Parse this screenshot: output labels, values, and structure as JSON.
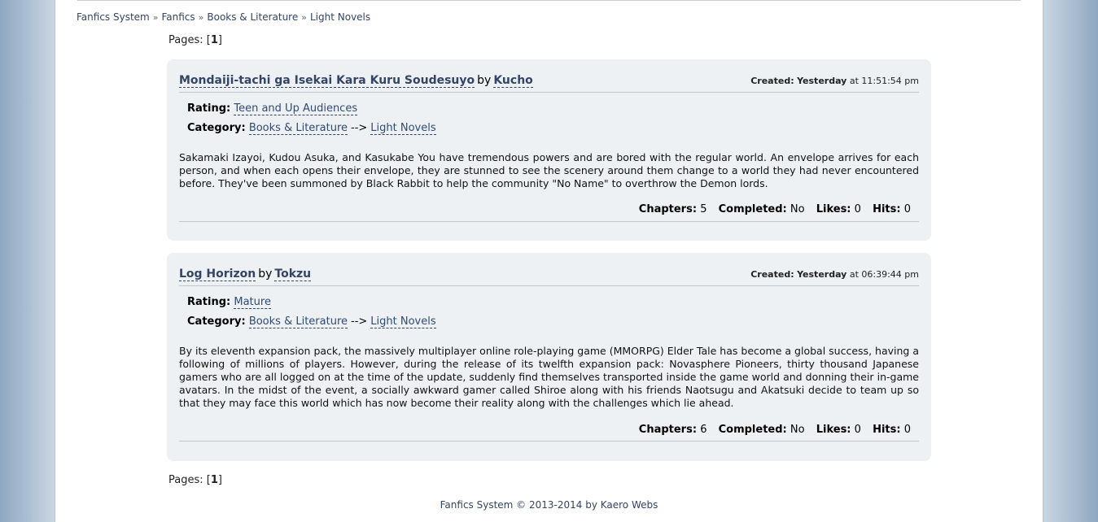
{
  "breadcrumb": [
    {
      "label": "Fanfics System"
    },
    {
      "label": "Fanfics"
    },
    {
      "label": "Books & Literature"
    },
    {
      "label": "Light Novels"
    }
  ],
  "breadcrumb_sep": "»",
  "pages": {
    "label": "Pages:",
    "current": "1"
  },
  "stories": [
    {
      "title": "Mondaiji-tachi ga Isekai Kara Kuru Soudesuyo",
      "by": "by",
      "author": "Kucho",
      "created_label": "Created:",
      "created_day": "Yesterday",
      "created_time": "at 11:51:54 pm",
      "rating_label": "Rating:",
      "rating": "Teen and Up Audiences",
      "category_label": "Category:",
      "category_parent": "Books & Literature",
      "category_arrow": "-->",
      "category_child": "Light Novels",
      "summary": "Sakamaki Izayoi, Kudou Asuka, and Kasukabe You have tremendous powers and are bored with the regular world. An envelope arrives for each person, and when each opens their envelope, they are stunned to see the scenery around them change to a world they had never encountered before. They've been summoned by Black Rabbit to help the community \"No Name\" to overthrow the Demon lords.",
      "chapters_label": "Chapters:",
      "chapters": "5",
      "completed_label": "Completed:",
      "completed": "No",
      "likes_label": "Likes:",
      "likes": "0",
      "hits_label": "Hits:",
      "hits": "0"
    },
    {
      "title": "Log Horizon",
      "by": "by",
      "author": "Tokzu",
      "created_label": "Created:",
      "created_day": "Yesterday",
      "created_time": "at 06:39:44 pm",
      "rating_label": "Rating:",
      "rating": "Mature",
      "category_label": "Category:",
      "category_parent": "Books & Literature",
      "category_arrow": "-->",
      "category_child": "Light Novels",
      "summary": "By its eleventh expansion pack, the massively multiplayer online role-playing game (MMORPG) Elder Tale has become a global success, having a following of millions of players. However, during the release of its twelfth expansion pack: Novasphere Pioneers, thirty thousand Japanese gamers who are all logged on at the time of the update, suddenly find themselves transported inside the game world and donning their in-game avatars. In the midst of the event, a socially awkward gamer called Shiroe along with his friends Naotsugu and Akatsuki decide to team up so that they may face this world which has now become their reality along with the challenges which lie ahead.",
      "chapters_label": "Chapters:",
      "chapters": "6",
      "completed_label": "Completed:",
      "completed": "No",
      "likes_label": "Likes:",
      "likes": "0",
      "hits_label": "Hits:",
      "hits": "0"
    }
  ],
  "footer": "Fanfics System © 2013-2014 by Kaero Webs"
}
